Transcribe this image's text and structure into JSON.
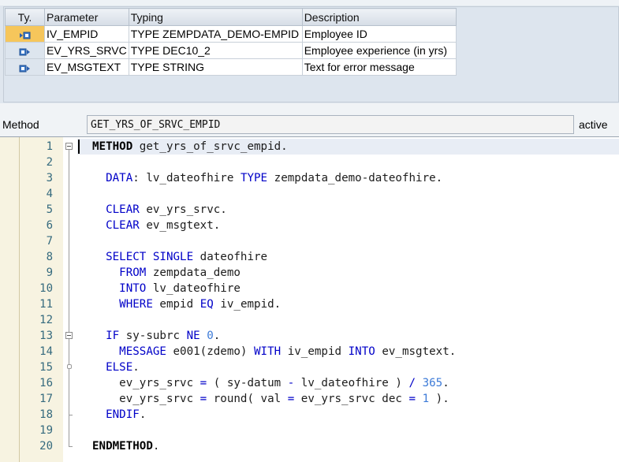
{
  "params": {
    "headers": [
      "Ty.",
      "Parameter",
      "Typing",
      "Description"
    ],
    "rows": [
      {
        "icon": "importing-parameter-icon",
        "name": "IV_EMPID",
        "typing": "TYPE ZEMPDATA_DEMO-EMPID",
        "desc": "Employee ID",
        "selected": true
      },
      {
        "icon": "exporting-parameter-icon",
        "name": "EV_YRS_SRVC",
        "typing": "TYPE DEC10_2",
        "desc": "Employee experience (in yrs)",
        "selected": false
      },
      {
        "icon": "exporting-parameter-icon",
        "name": "EV_MSGTEXT",
        "typing": "TYPE STRING",
        "desc": "Text for error message",
        "selected": false
      }
    ]
  },
  "method": {
    "label": "Method",
    "name": "GET_YRS_OF_SRVC_EMPID",
    "status": "active"
  },
  "code": {
    "line_numbers": [
      "1",
      "2",
      "3",
      "4",
      "5",
      "6",
      "7",
      "8",
      "9",
      "10",
      "11",
      "12",
      "13",
      "14",
      "15",
      "16",
      "17",
      "18",
      "19",
      "20"
    ],
    "lines": [
      [
        {
          "t": "METHOD",
          "c": "kwb"
        },
        {
          "t": " get_yrs_of_srvc_empid.",
          "c": ""
        }
      ],
      [],
      [
        {
          "t": "  ",
          "c": ""
        },
        {
          "t": "DATA",
          "c": "kw"
        },
        {
          "t": ": lv_dateofhire ",
          "c": ""
        },
        {
          "t": "TYPE",
          "c": "kw"
        },
        {
          "t": " zempdata_demo-dateofhire.",
          "c": ""
        }
      ],
      [],
      [
        {
          "t": "  ",
          "c": ""
        },
        {
          "t": "CLEAR",
          "c": "kw"
        },
        {
          "t": " ev_yrs_srvc.",
          "c": ""
        }
      ],
      [
        {
          "t": "  ",
          "c": ""
        },
        {
          "t": "CLEAR",
          "c": "kw"
        },
        {
          "t": " ev_msgtext.",
          "c": ""
        }
      ],
      [],
      [
        {
          "t": "  ",
          "c": ""
        },
        {
          "t": "SELECT SINGLE",
          "c": "kw"
        },
        {
          "t": " dateofhire",
          "c": ""
        }
      ],
      [
        {
          "t": "    ",
          "c": ""
        },
        {
          "t": "FROM",
          "c": "kw"
        },
        {
          "t": " zempdata_demo",
          "c": ""
        }
      ],
      [
        {
          "t": "    ",
          "c": ""
        },
        {
          "t": "INTO",
          "c": "kw"
        },
        {
          "t": " lv_dateofhire",
          "c": ""
        }
      ],
      [
        {
          "t": "    ",
          "c": ""
        },
        {
          "t": "WHERE",
          "c": "kw"
        },
        {
          "t": " empid ",
          "c": ""
        },
        {
          "t": "EQ",
          "c": "kw"
        },
        {
          "t": " iv_empid.",
          "c": ""
        }
      ],
      [],
      [
        {
          "t": "  ",
          "c": ""
        },
        {
          "t": "IF",
          "c": "kw"
        },
        {
          "t": " sy-subrc ",
          "c": ""
        },
        {
          "t": "NE",
          "c": "kw"
        },
        {
          "t": " ",
          "c": ""
        },
        {
          "t": "0",
          "c": "lit"
        },
        {
          "t": ".",
          "c": ""
        }
      ],
      [
        {
          "t": "    ",
          "c": ""
        },
        {
          "t": "MESSAGE",
          "c": "kw"
        },
        {
          "t": " e001(zdemo) ",
          "c": ""
        },
        {
          "t": "WITH",
          "c": "kw"
        },
        {
          "t": " iv_empid ",
          "c": ""
        },
        {
          "t": "INTO",
          "c": "kw"
        },
        {
          "t": " ev_msgtext.",
          "c": ""
        }
      ],
      [
        {
          "t": "  ",
          "c": ""
        },
        {
          "t": "ELSE",
          "c": "kw"
        },
        {
          "t": ".",
          "c": ""
        }
      ],
      [
        {
          "t": "    ev_yrs_srvc ",
          "c": ""
        },
        {
          "t": "=",
          "c": "kw"
        },
        {
          "t": " ( sy-datum ",
          "c": ""
        },
        {
          "t": "-",
          "c": "kw"
        },
        {
          "t": " lv_dateofhire ) ",
          "c": ""
        },
        {
          "t": "/",
          "c": "kw"
        },
        {
          "t": " ",
          "c": ""
        },
        {
          "t": "365",
          "c": "lit"
        },
        {
          "t": ".",
          "c": ""
        }
      ],
      [
        {
          "t": "    ev_yrs_srvc ",
          "c": ""
        },
        {
          "t": "=",
          "c": "kw"
        },
        {
          "t": " round( val ",
          "c": ""
        },
        {
          "t": "=",
          "c": "kw"
        },
        {
          "t": " ev_yrs_srvc dec ",
          "c": ""
        },
        {
          "t": "=",
          "c": "kw"
        },
        {
          "t": " ",
          "c": ""
        },
        {
          "t": "1",
          "c": "lit"
        },
        {
          "t": " ).",
          "c": ""
        }
      ],
      [
        {
          "t": "  ",
          "c": ""
        },
        {
          "t": "ENDIF",
          "c": "kw"
        },
        {
          "t": ".",
          "c": ""
        }
      ],
      [],
      [
        {
          "t": "ENDMETHOD",
          "c": "kwb"
        },
        {
          "t": ".",
          "c": ""
        }
      ]
    ]
  }
}
